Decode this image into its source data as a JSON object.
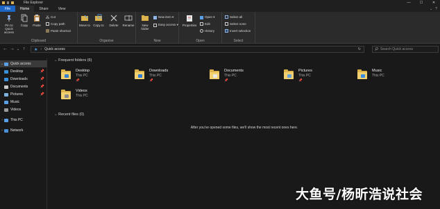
{
  "window": {
    "title": "File Explorer",
    "controls": [
      "—",
      "☐",
      "✕"
    ]
  },
  "ribbon_tabs": [
    "File",
    "Home",
    "Share",
    "View"
  ],
  "ribbon_tabs_right": [
    "⌄",
    "?"
  ],
  "ribbon": {
    "clipboard": {
      "pin_label": "Pin to Quick access",
      "copy": "Copy",
      "paste": "Paste",
      "cut": "Cut",
      "copy_path": "Copy path",
      "paste_shortcut": "Paste shortcut",
      "group": "Clipboard"
    },
    "organise": {
      "move_to": "Move to",
      "copy_to": "Copy to",
      "delete": "Delete",
      "rename": "Rename",
      "group": "Organise"
    },
    "new": {
      "new_folder": "New folder",
      "new_item": "New item ▾",
      "easy_access": "Easy access ▾",
      "group": "New"
    },
    "open": {
      "properties": "Properties",
      "open": "Open ▾",
      "edit": "Edit",
      "history": "History",
      "group": "Open"
    },
    "select": {
      "select_all": "Select all",
      "select_none": "Select none",
      "invert_selection": "Invert selection",
      "group": "Select"
    }
  },
  "address": {
    "back": "←",
    "forward": "→",
    "recent": "⌄",
    "up": "↑",
    "path": "Quick access",
    "refresh": "↻",
    "search_placeholder": "Search Quick access"
  },
  "sidebar": {
    "quick_access": "Quick access",
    "items": [
      {
        "label": "Desktop",
        "color": "#3a8fd8"
      },
      {
        "label": "Downloads",
        "color": "#3a8fd8"
      },
      {
        "label": "Documents",
        "color": "#c8c8c8"
      },
      {
        "label": "Pictures",
        "color": "#7fb2e0"
      },
      {
        "label": "Music",
        "color": "#5aa0e6"
      },
      {
        "label": "Videos",
        "color": "#9a9a9a"
      }
    ],
    "this_pc": "This PC",
    "network": "Network"
  },
  "main": {
    "frequent_heading": "Frequent folders (6)",
    "folders": [
      {
        "name": "Desktop",
        "location": "This PC",
        "badge": "#3a7fd0"
      },
      {
        "name": "Downloads",
        "location": "This PC",
        "badge": "#2f7dd6"
      },
      {
        "name": "Documents",
        "location": "This PC",
        "badge": "#e8e8e8"
      },
      {
        "name": "Pictures",
        "location": "This PC",
        "badge": "#6aa3d8"
      },
      {
        "name": "Music",
        "location": "This PC",
        "badge": "#3d8de0"
      },
      {
        "name": "Videos",
        "location": "This PC",
        "badge": "#8a8a8a"
      }
    ],
    "recent_heading": "Recent files (0)",
    "empty_message": "After you've opened some files, we'll show the most recent ones here."
  },
  "watermark": "大鱼号/杨昕浩说社会",
  "colors": {
    "accent": "#1d66c5",
    "folder": "#f2cf6f",
    "background": "#191919",
    "ribbon": "#2b2b2b"
  }
}
